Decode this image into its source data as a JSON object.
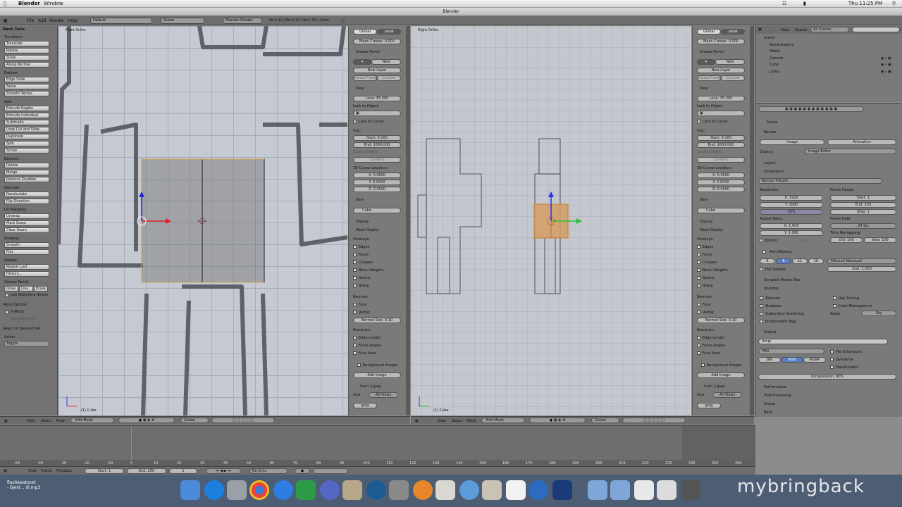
{
  "menubar": {
    "app": "Blender",
    "window": "Window",
    "clock": "Thu 11:25 PM"
  },
  "window_title": "Blender",
  "info_header": {
    "menus": [
      "File",
      "Add",
      "Render",
      "Help"
    ],
    "layout": "Default",
    "scene": "Scene",
    "engine": "Blender Render",
    "stats": "Ve:4-12 | Ed:4-20 | Fa:1-10 | Cube"
  },
  "tool_shelf": {
    "title": "Mesh Tools",
    "sections": [
      {
        "label": "Transform:",
        "items": [
          "Translate",
          "Rotate",
          "Scale",
          "Along Normal"
        ]
      },
      {
        "label": "Deform:",
        "items": [
          "Edge Slide",
          "Noise",
          "Smooth Vertex"
        ]
      },
      {
        "label": "Add:",
        "items": [
          "Extrude Region",
          "Extrude Individual",
          "Subdivide",
          "Loop Cut and Slide",
          "Duplicate",
          "Spin",
          "Screw"
        ]
      },
      {
        "label": "Remove:",
        "items": [
          "Delete",
          "Merge",
          "Remove Doubles"
        ]
      },
      {
        "label": "Normals:",
        "items": [
          "Recalculate",
          "Flip Direction"
        ]
      },
      {
        "label": "UV Mapping:",
        "items": [
          "Unwrap",
          "Mark Seam",
          "Clear Seam"
        ]
      },
      {
        "label": "Shading:",
        "items": [
          "Smooth",
          "Flat"
        ]
      },
      {
        "label": "Repeat:",
        "items": [
          "Repeat Last",
          "History..."
        ]
      }
    ],
    "grease_label": "Grease Pencil:",
    "grease_buttons": [
      "Draw",
      "Line",
      "Erase"
    ],
    "sketch": "Use Sketching Sessio",
    "mesh_options": "Mesh Options",
    "x_mirror": "X Mirror",
    "topology_mirror": "Topology Mirror",
    "op_title": "Select or Deselect All",
    "action_label": "Action",
    "action_value": "Toggle"
  },
  "left_viewport": {
    "label": "Front Ortho",
    "object_label": "(1) Cube"
  },
  "right_viewport": {
    "label": "Right Ortho",
    "object_label": "(1) Cube"
  },
  "n_panel": {
    "global": "Global",
    "local": "Local",
    "mean_crease": "Mean Crease: 0.000",
    "grease_pencil": "Grease Pencil",
    "new": "New",
    "new_layer": "New Layer",
    "delete_frame": "Delete Frame",
    "convert": "Convert",
    "view": "View",
    "lens": "Lens: 35.000",
    "lock_to_object": "Lock to Object:",
    "lock_to_cursor": "Lock to Cursor",
    "clip": "Clip:",
    "clip_start": "Start: 0.100",
    "clip_end": "End: 1000.000",
    "local_camera": "Local Camera:",
    "camera": "Camera",
    "cursor_loc": "3D Cursor Location:",
    "cx": "X: 0.0000",
    "cy": "Y: 0.0000",
    "cz": "Z: 0.0000",
    "item": "Item",
    "item_name": "Cube",
    "display": "Display",
    "mesh_display": "Mesh Display",
    "overlays": "Overlays:",
    "overlay_items": [
      "Edges",
      "Faces",
      "Creases",
      "Bevel Weights",
      "Seams",
      "Sharp"
    ],
    "normals": "Normals:",
    "normal_items": [
      "Face",
      "Vertex"
    ],
    "normal_size": "Normal Size: 0.10",
    "numerics": "Numerics:",
    "numeric_items": [
      "Edge Length",
      "Faces Angles",
      "Face Area"
    ],
    "bg_images": "Background Images",
    "add_image": "Add Image",
    "scan_file": "Scan 2.jpeg",
    "axis": "Axis:",
    "all_views": "All Views",
    "jpeg": "jpeg"
  },
  "view_header": {
    "view": "View",
    "select": "Select",
    "mesh": "Mesh",
    "mode": "Edit Mode",
    "orientation": "Global"
  },
  "outliner": {
    "view": "View",
    "search": "Search",
    "filter": "All Scenes",
    "items": [
      "Scene",
      "RenderLayers",
      "World",
      "Camera",
      "Cube",
      "Lamp"
    ]
  },
  "properties": {
    "scene": "Scene",
    "render": "Render",
    "image": "Image",
    "animation": "Animation",
    "display_label": "Display:",
    "display_value": "Image Editor",
    "layers": "Layers",
    "dimensions": "Dimensions",
    "render_presets": "Render Presets",
    "resolution": "Resolution:",
    "res_x": "X: 1920",
    "res_y": "Y: 1080",
    "res_pct": "50%",
    "frame_range": "Frame Range:",
    "start": "Start: 1",
    "end": "End: 250",
    "step": "Step: 1",
    "aspect": "Aspect Ratio:",
    "asp_x": "X: 1.000",
    "asp_y": "Y: 1.000",
    "frame_rate": "Frame Rate:",
    "fps": "24 fps",
    "time_remap": "Time Remapping:",
    "old": "Old: 100",
    "new": "New: 100",
    "border": "Border",
    "crop": "Crop",
    "anti_aliasing": "Anti-Aliasing",
    "aa_levels": [
      "5",
      "8",
      "11",
      "16"
    ],
    "filter": "Mitchell-Netravali",
    "full_sample": "Full Sample",
    "size": "Size: 1.000",
    "motion_blur": "Sampled Motion Blur",
    "shading": "Shading",
    "shading_left": [
      "Textures",
      "Shadows",
      "Subsurface Scattering",
      "Environment Map"
    ],
    "ray_tracing": "Ray Tracing",
    "color_mgmt": "Color Management",
    "alpha": "Alpha:",
    "sky": "Sky",
    "output": "Output",
    "path": "/tmp/",
    "format": "PNG",
    "file_ext": "File Extensions",
    "overwrite": "Overwrite",
    "placeholders": "Placeholders",
    "bw": "BW",
    "rgb": "RGB",
    "rgba": "RGBA",
    "compression": "Compression: 90%",
    "performance": "Performance",
    "post": "Post Processing",
    "stamp": "Stamp",
    "bake": "Bake"
  },
  "timeline": {
    "ticks": [
      "-50",
      "-40",
      "-30",
      "-20",
      "-10",
      "0",
      "10",
      "20",
      "30",
      "40",
      "50",
      "60",
      "70",
      "80",
      "90",
      "100",
      "110",
      "120",
      "130",
      "140",
      "150",
      "160",
      "170",
      "180",
      "190",
      "200",
      "210",
      "220",
      "230",
      "240",
      "250",
      "260"
    ],
    "view": "View",
    "frame": "Frame",
    "playback": "Playback",
    "start": "Start: 1",
    "end": "End: 250",
    "current": "1",
    "sync": "No Sync"
  },
  "desktop": {
    "file1": "flashbeatsnet",
    "file2": "- bjest... dl.mp3",
    "watermark": "mybringback"
  }
}
